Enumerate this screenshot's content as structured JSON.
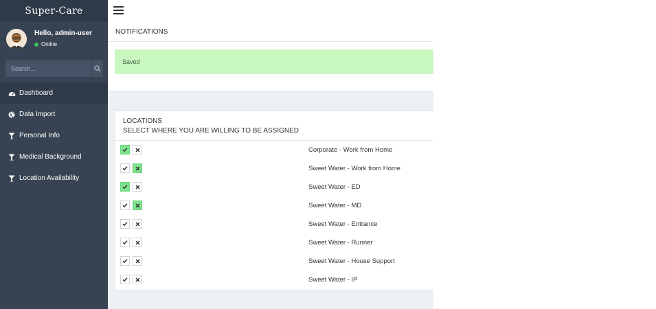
{
  "app": {
    "brand": "Super-Care"
  },
  "user": {
    "greeting": "Hello, admin-user",
    "status": "Online"
  },
  "search": {
    "placeholder": "Search..."
  },
  "sidebar": {
    "items": [
      {
        "label": "Dashboard",
        "icon": "dashboard-icon",
        "active": true
      },
      {
        "label": "Data Import",
        "icon": "globe-icon",
        "active": false
      },
      {
        "label": "Personal Info",
        "icon": "glass-icon",
        "active": false
      },
      {
        "label": "Medical Background",
        "icon": "glass-icon",
        "active": false
      },
      {
        "label": "Location Availability",
        "icon": "glass-icon",
        "active": false
      }
    ]
  },
  "notifications": {
    "title": "NOTIFICATIONS",
    "message": "Saved"
  },
  "locations": {
    "title": "LOCATIONS",
    "subtitle": "SELECT WHERE YOU ARE WILLING TO BE ASSIGNED",
    "rows": [
      {
        "label": "Corporate - Work from Home",
        "selected": "yes"
      },
      {
        "label": "Sweet Water - Work from Home",
        "selected": "no"
      },
      {
        "label": "Sweet Water - ED",
        "selected": "yes"
      },
      {
        "label": "Sweet Water - MD",
        "selected": "no"
      },
      {
        "label": "Sweet Water - Entrance",
        "selected": "none"
      },
      {
        "label": "Sweet Water - Runner",
        "selected": "none"
      },
      {
        "label": "Sweet Water - House Support",
        "selected": "none"
      },
      {
        "label": "Sweet Water - IP",
        "selected": "none"
      }
    ]
  },
  "colors": {
    "sidebar_bg": "#374352",
    "sidebar_active": "#2f3a48",
    "alert_success": "#c8f7c0",
    "toggle_on": "#7de38e",
    "status_online": "#3bbf5a"
  }
}
